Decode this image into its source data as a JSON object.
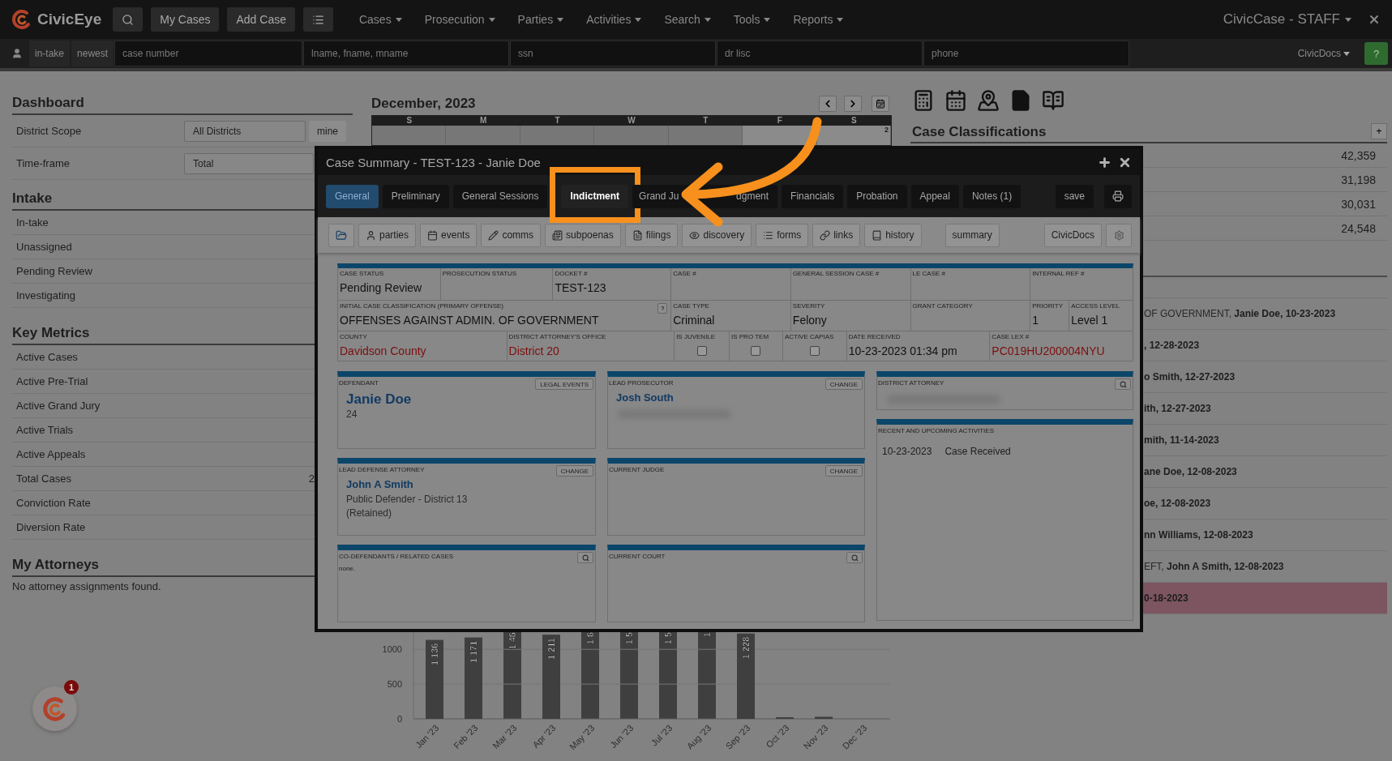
{
  "nav": {
    "brand": "CivicEye",
    "buttons": [
      "My Cases",
      "Add Case"
    ],
    "menus": [
      "Cases",
      "Prosecution",
      "Parties",
      "Activities",
      "Search",
      "Tools",
      "Reports"
    ],
    "account": "CivicCase - STAFF"
  },
  "quick_search": {
    "filters": [
      "in-take",
      "newest"
    ],
    "fields": [
      {
        "placeholder": "case number"
      },
      {
        "placeholder": "lname, fname, mname"
      },
      {
        "placeholder": "ssn"
      },
      {
        "placeholder": "dr lisc"
      },
      {
        "placeholder": "phone"
      }
    ],
    "docs_menu": "CivicDocs",
    "help": "?"
  },
  "dashboard": {
    "title": "Dashboard",
    "filters": [
      {
        "label": "District Scope",
        "value": "All Districts",
        "button": "mine"
      },
      {
        "label": "Time-frame",
        "value": "Total"
      }
    ],
    "sections": [
      {
        "title": "Intake",
        "rows": [
          {
            "label": "In-take"
          },
          {
            "label": "Unassigned"
          },
          {
            "label": "Pending Review"
          },
          {
            "label": "Investigating"
          }
        ]
      },
      {
        "title": "Key Metrics",
        "rows": [
          {
            "label": "Active Cases"
          },
          {
            "label": "Active Pre-Trial"
          },
          {
            "label": "Active Grand Jury"
          },
          {
            "label": "Active Trials"
          },
          {
            "label": "Active Appeals"
          },
          {
            "label": "Total Cases",
            "value": "2"
          },
          {
            "label": "Conviction Rate"
          },
          {
            "label": "Diversion Rate"
          }
        ]
      },
      {
        "title": "My Attorneys",
        "note": "No attorney assignments found."
      }
    ]
  },
  "calendar": {
    "title": "December, 2023",
    "weekdays": [
      "S",
      "M",
      "T",
      "W",
      "T",
      "F",
      "S"
    ],
    "cells": [
      {
        "in_month": false
      },
      {
        "in_month": false
      },
      {
        "in_month": false
      },
      {
        "in_month": false
      },
      {
        "in_month": false
      },
      {
        "in_month": true
      },
      {
        "in_month": true,
        "day": "2"
      }
    ]
  },
  "chart": {
    "chart_data": {
      "type": "bar",
      "categories": [
        "Jan '23",
        "Feb '23",
        "Mar '23",
        "Apr '23",
        "May '23",
        "Jun '23",
        "Jul '23",
        "Aug '23",
        "Sep '23",
        "Oct '23",
        "Nov '23",
        "Dec '23"
      ],
      "values": [
        1136,
        1171,
        null,
        1211,
        null,
        null,
        null,
        null,
        1228,
        20,
        30,
        0
      ],
      "ylim": [
        0,
        1294
      ],
      "yticks": [
        0,
        500,
        1000
      ],
      "value_labels": [
        "1 136",
        "1 171",
        "1 46",
        "1 211",
        "1 6",
        "1 5",
        "1 5",
        "1",
        "1 228",
        null,
        null,
        null
      ]
    }
  },
  "case_classifications": {
    "title": "Case Classifications",
    "add": "+",
    "counts": [
      "42,359",
      "31,198",
      "30,031",
      "24,548"
    ]
  },
  "recent_cases": [
    {
      "prefix": "OF GOVERNMENT, ",
      "detail": "Janie Doe, 10-23-2023",
      "highlighted": false
    },
    {
      "detail": ", 12-28-2023",
      "highlighted": false
    },
    {
      "detail": "o Smith, 12-27-2023",
      "highlighted": false
    },
    {
      "detail": "ith, 12-27-2023",
      "highlighted": false
    },
    {
      "detail": "mith, 11-14-2023",
      "highlighted": false
    },
    {
      "detail": "ane Doe, 12-08-2023",
      "highlighted": false
    },
    {
      "detail": "oe, 12-08-2023",
      "highlighted": false
    },
    {
      "detail": "nn Williams, 12-08-2023",
      "highlighted": false
    },
    {
      "prefix": "EFT, ",
      "detail": "John A Smith, 12-08-2023",
      "highlighted": false
    },
    {
      "detail": "0-18-2023",
      "highlighted": true
    }
  ],
  "modal": {
    "title": "Case Summary - TEST-123 - Janie Doe",
    "tabs": [
      {
        "label": "General",
        "selected": true,
        "highlighted": false
      },
      {
        "label": "Preliminary",
        "selected": false,
        "highlighted": false
      },
      {
        "label": "General Sessions",
        "selected": false,
        "highlighted": false
      },
      {
        "label": "Indictment",
        "selected": false,
        "highlighted": true
      },
      {
        "label": "Grand Ju",
        "selected": false,
        "highlighted": false
      },
      {
        "label": "dgment",
        "selected": false,
        "highlighted": false
      },
      {
        "label": "Financials",
        "selected": false,
        "highlighted": false
      },
      {
        "label": "Probation",
        "selected": false,
        "highlighted": false
      },
      {
        "label": "Appeal",
        "selected": false,
        "highlighted": false
      },
      {
        "label": "Notes (1)",
        "selected": false,
        "highlighted": false
      }
    ],
    "save": "save",
    "toolbar": [
      {
        "kind": "folder"
      },
      {
        "kind": "parties",
        "label": "parties"
      },
      {
        "kind": "events",
        "label": "events"
      },
      {
        "kind": "comms",
        "label": "comms"
      },
      {
        "kind": "subpoenas",
        "label": "subpoenas"
      },
      {
        "kind": "filings",
        "label": "filings"
      },
      {
        "kind": "discovery",
        "label": "discovery"
      },
      {
        "kind": "forms",
        "label": "forms"
      },
      {
        "kind": "links",
        "label": "links"
      },
      {
        "kind": "history",
        "label": "history"
      }
    ],
    "summary": "summary",
    "docs": "CivicDocs",
    "fields": [
      [
        {
          "label": "CASE STATUS",
          "kind": "text",
          "value": "Pending Review"
        },
        {
          "label": "PROSECUTION STATUS",
          "kind": "text"
        },
        {
          "label": "DOCKET #",
          "kind": "text",
          "value": "TEST-123"
        },
        {
          "label": "CASE #",
          "kind": "text"
        },
        {
          "label": "GENERAL SESSION CASE #",
          "kind": "text"
        },
        {
          "label": "LE CASE #",
          "kind": "text"
        },
        {
          "label": "INTERNAL REF #",
          "kind": "text"
        }
      ],
      [
        {
          "label": "INITIAL CASE CLASSIFICATION (PRIMARY OFFENSE)",
          "kind": "text",
          "value": "OFFENSES AGAINST ADMIN. OF GOVERNMENT",
          "help": "?"
        },
        {
          "label": "CASE TYPE",
          "kind": "text",
          "value": "Criminal"
        },
        {
          "label": "SEVERITY",
          "kind": "text",
          "value": "Felony"
        },
        {
          "label": "GRANT CATEGORY",
          "kind": "text"
        },
        {
          "label": "PRIORITY",
          "kind": "text",
          "value": "1"
        },
        {
          "label": "ACCESS LEVEL",
          "kind": "text",
          "value": "Level 1"
        }
      ],
      [
        {
          "label": "COUNTY",
          "kind": "alert",
          "value": "Davidson County"
        },
        {
          "label": "DISTRICT ATTORNEY'S OFFICE",
          "kind": "alert",
          "value": "District 20"
        },
        {
          "label": "IS JUVENILE",
          "kind": "checkbox",
          "checked": false
        },
        {
          "label": "IS PRO TEM",
          "kind": "checkbox",
          "checked": false
        },
        {
          "label": "ACTIVE CAPIAS",
          "kind": "checkbox",
          "checked": false
        },
        {
          "label": "DATE RECEIVED",
          "kind": "text",
          "value": "10-23-2023 01:34 pm"
        },
        {
          "label": "CASE LEX #",
          "kind": "alert",
          "value": "PC019HU200004NYU"
        }
      ]
    ],
    "card_columns": [
      [
        {
          "title": "DEFENDANT",
          "action": {
            "kind": "button",
            "label": "LEGAL EVENTS"
          },
          "lines": [
            {
              "kind": "name",
              "text": "Janie Doe"
            },
            {
              "kind": "plain",
              "text": "24"
            }
          ]
        },
        {
          "title": "LEAD DEFENSE ATTORNEY",
          "action": {
            "kind": "button",
            "label": "CHANGE"
          },
          "lines": [
            {
              "kind": "subname",
              "text": "John A Smith"
            },
            {
              "kind": "plain",
              "text": "Public Defender - District 13"
            },
            {
              "kind": "plain",
              "text": "(Retained)"
            }
          ]
        },
        {
          "title": "CO-DEFENDANTS / RELATED CASES",
          "action": {
            "kind": "search"
          },
          "lines": [
            {
              "kind": "small",
              "text": "none."
            }
          ]
        }
      ],
      [
        {
          "title": "LEAD PROSECUTOR",
          "action": {
            "kind": "button",
            "label": "CHANGE"
          },
          "lines": [
            {
              "kind": "subname",
              "text": "Josh South"
            },
            {
              "kind": "redacted"
            }
          ]
        },
        {
          "title": "CURRENT JUDGE",
          "action": {
            "kind": "button",
            "label": "CHANGE"
          }
        },
        {
          "title": "CURRENT COURT",
          "action": {
            "kind": "search"
          }
        }
      ],
      [
        {
          "title": "DISTRICT ATTORNEY",
          "action": {
            "kind": "search"
          },
          "lines": [
            {
              "kind": "redacted"
            }
          ]
        },
        {
          "title": "RECENT AND UPCOMING ACTIVITIES",
          "lines": [
            {
              "kind": "activity",
              "date": "10-23-2023",
              "text": "Case Received"
            }
          ]
        }
      ]
    ]
  },
  "assistant": {
    "badge": "1"
  }
}
